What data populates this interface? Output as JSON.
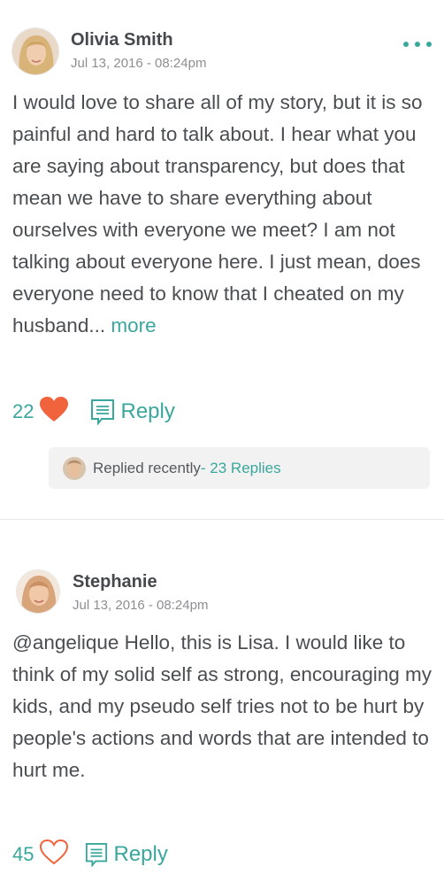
{
  "posts": [
    {
      "author": "Olivia Smith",
      "date": "Jul 13, 2016 - 08:24pm",
      "body": "I would love to share all of my story, but it is so painful and hard to talk about. I hear what you are saying about transparency, but does that mean we have to share everything about ourselves with everyone we meet? I am not talking about everyone here. I just mean, does everyone need to know that I cheated on my husband...",
      "more_label": "more",
      "likes": "22",
      "liked": true,
      "reply_label": "Reply",
      "replied_label": "Replied recently",
      "replies_count": "- 23 Replies"
    },
    {
      "author": "Stephanie",
      "date": "Jul 13, 2016 - 08:24pm",
      "body": "@angelique Hello, this is Lisa. I would like to think of my solid self as strong, encouraging my kids, and my pseudo self tries not to be hurt by people's actions and words that are intended to hurt me.",
      "likes": "45",
      "liked": false,
      "reply_label": "Reply"
    }
  ],
  "colors": {
    "accent": "#3aa79c",
    "heart": "#f0633c",
    "text": "#4a4e52",
    "muted": "#8c8f92"
  }
}
